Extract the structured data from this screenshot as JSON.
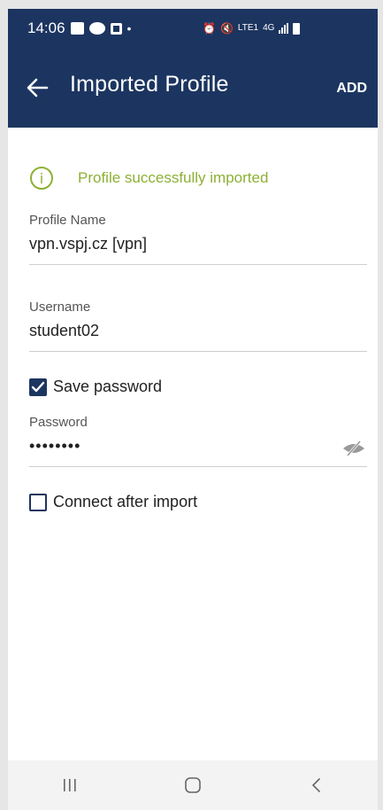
{
  "status_bar": {
    "time": "14:06",
    "network": "4G",
    "volte": "VoLTE",
    "lte": "LTE1"
  },
  "app_bar": {
    "title": "Imported Profile",
    "add_label": "ADD"
  },
  "notice": {
    "text": "Profile successfully imported",
    "color": "#8db034"
  },
  "form": {
    "profile_name": {
      "label": "Profile Name",
      "value": "vpn.vspj.cz [vpn]"
    },
    "username": {
      "label": "Username",
      "value": "student02"
    },
    "save_password": {
      "label": "Save password",
      "checked": true
    },
    "password": {
      "label": "Password",
      "value": "••••••••"
    },
    "connect_after_import": {
      "label": "Connect after import",
      "checked": false
    }
  },
  "colors": {
    "primary": "#1c3560",
    "success": "#8db034"
  },
  "icons": {
    "back": "arrow-left-icon",
    "info": "info-icon",
    "visibility": "eye-off-icon",
    "nav_recents": "recents-icon",
    "nav_home": "home-icon",
    "nav_back": "chevron-left-icon"
  }
}
